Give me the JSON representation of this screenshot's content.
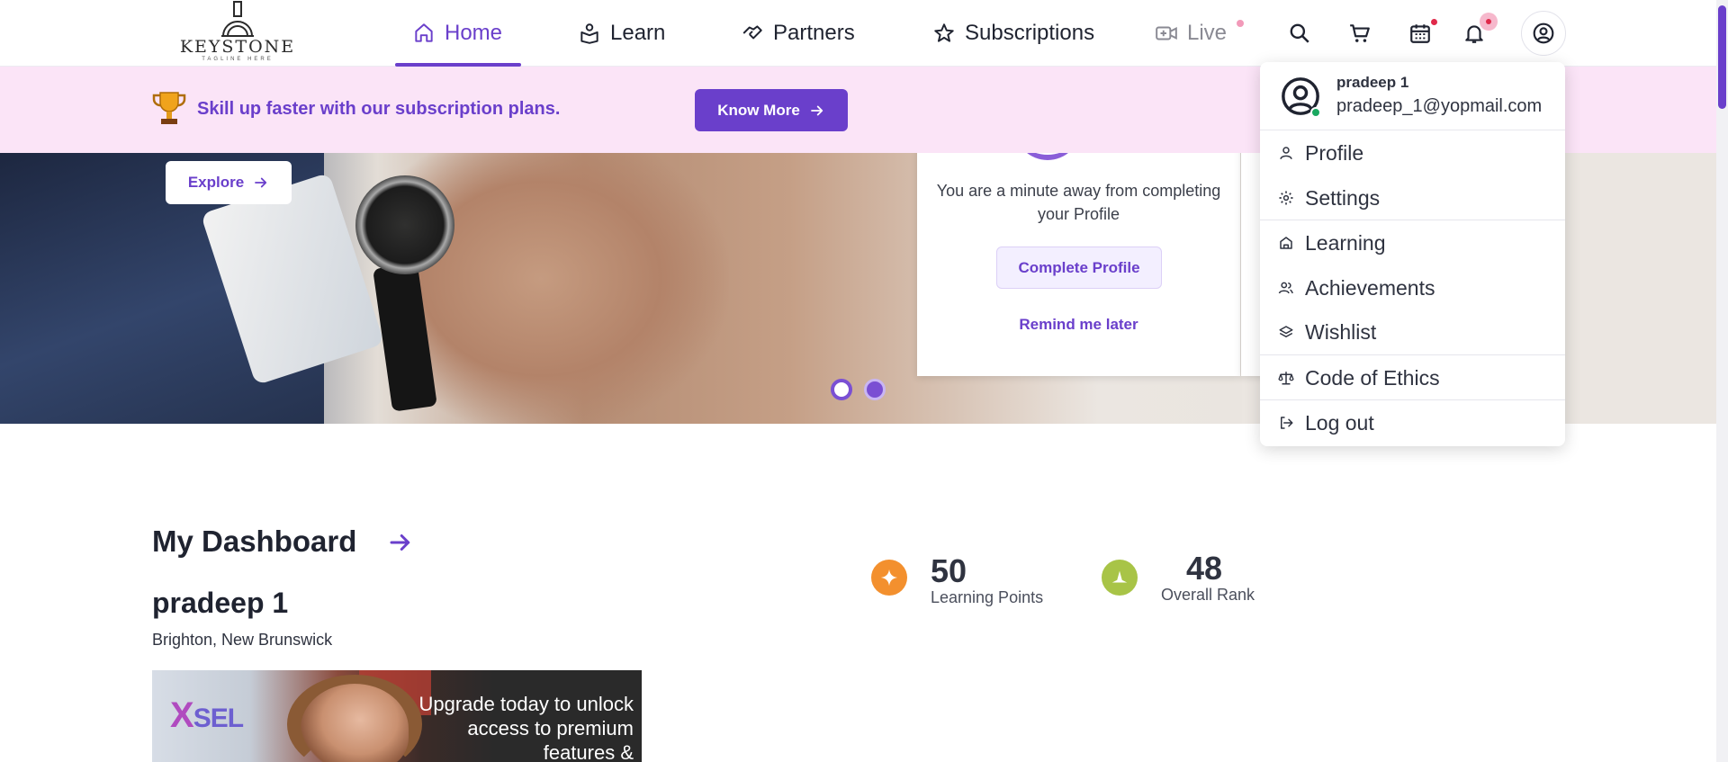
{
  "brand": {
    "name": "KEYSTONE",
    "tagline": "TAGLINE HERE"
  },
  "nav": {
    "items": [
      {
        "label": "Home",
        "icon": "home-icon",
        "active": true
      },
      {
        "label": "Learn",
        "icon": "book-user-icon",
        "active": false
      },
      {
        "label": "Partners",
        "icon": "handshake-icon",
        "active": false
      },
      {
        "label": "Subscriptions",
        "icon": "star-icon",
        "active": false
      },
      {
        "label": "Live",
        "icon": "video-plus-icon",
        "active": false
      }
    ],
    "icons": [
      "search-icon",
      "cart-icon",
      "calendar-icon",
      "bell-icon",
      "user-circle-icon"
    ]
  },
  "promo": {
    "text": "Skill up faster with our subscription plans.",
    "button_label": "Know More"
  },
  "hero": {
    "explore_label": "Explore"
  },
  "profile_card": {
    "message": "You are a minute away from completing your Profile",
    "complete_label": "Complete Profile",
    "remind_label": "Remind me later"
  },
  "dashboard": {
    "title": "My Dashboard",
    "user_name": "pradeep 1",
    "location": "Brighton, New Brunswick",
    "stats": [
      {
        "value": "50",
        "label": "Learning Points"
      },
      {
        "value": "48",
        "label": "Overall Rank"
      }
    ]
  },
  "ad": {
    "logo_x": "X",
    "logo_rest": "SEL",
    "text": "Upgrade today to unlock access to premium features &"
  },
  "user_menu": {
    "name": "pradeep 1",
    "email": "pradeep_1@yopmail.com",
    "items": [
      {
        "label": "Profile",
        "icon": "user-icon"
      },
      {
        "label": "Settings",
        "icon": "gear-icon"
      },
      {
        "label": "Learning",
        "icon": "learning-icon"
      },
      {
        "label": "Achievements",
        "icon": "users-icon"
      },
      {
        "label": "Wishlist",
        "icon": "layers-icon"
      },
      {
        "label": "Code of Ethics",
        "icon": "scale-icon"
      },
      {
        "label": "Log out",
        "icon": "logout-icon"
      }
    ]
  },
  "colors": {
    "accent": "#6a3fcb",
    "promo_bg": "#fbe4f7",
    "points": "#f3902e",
    "rank": "#a8c447",
    "online": "#1aa860"
  }
}
